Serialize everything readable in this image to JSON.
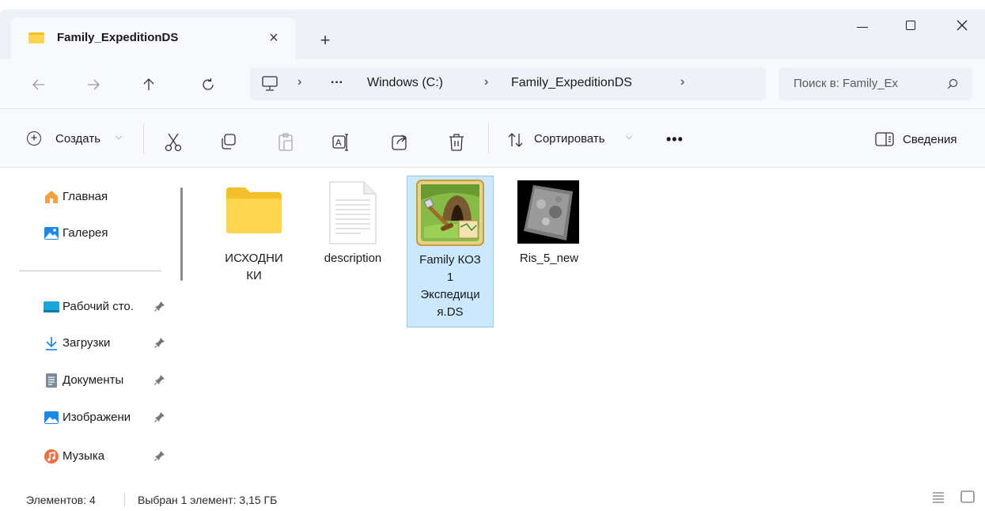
{
  "window": {
    "tab_title": "Family_ExpeditionDS",
    "minimize_label": "—",
    "close_tab_label": "×",
    "new_tab_label": "+"
  },
  "address": {
    "crumbs": [
      "Windows (C:)",
      "Family_ExpeditionDS"
    ],
    "ellipsis": "···",
    "separator": "›"
  },
  "search": {
    "placeholder": "Поиск в: Family_Ex"
  },
  "toolbar": {
    "create_label": "Создать",
    "sort_label": "Сортировать",
    "more_label": "•••",
    "details_label": "Сведения"
  },
  "navigation": {
    "home": "Главная",
    "gallery": "Галерея",
    "desktop": "Рабочий сто.",
    "downloads": "Загрузки",
    "documents": "Документы",
    "pictures": "Изображени",
    "music": "Музыка"
  },
  "files": [
    {
      "name_line1": "ИСХОДНИ",
      "name_line2": "КИ",
      "type": "folder"
    },
    {
      "name_line1": "description",
      "type": "text"
    },
    {
      "name_line1": "Family КОЗ",
      "name_line2": "1",
      "name_line3": "Экспедици",
      "name_line4": "я.DS",
      "type": "app",
      "selected": true
    },
    {
      "name_line1": "Ris_5_new",
      "type": "image"
    }
  ],
  "status": {
    "count": "Элементов: 4",
    "selection": "Выбран 1 элемент: 3,15 ГБ"
  },
  "colors": {
    "accent": "#0078d4",
    "selection_bg": "#cce8ff",
    "folder_yellow": "#ffd44f",
    "titlebar_bg": "#eef1f8"
  }
}
